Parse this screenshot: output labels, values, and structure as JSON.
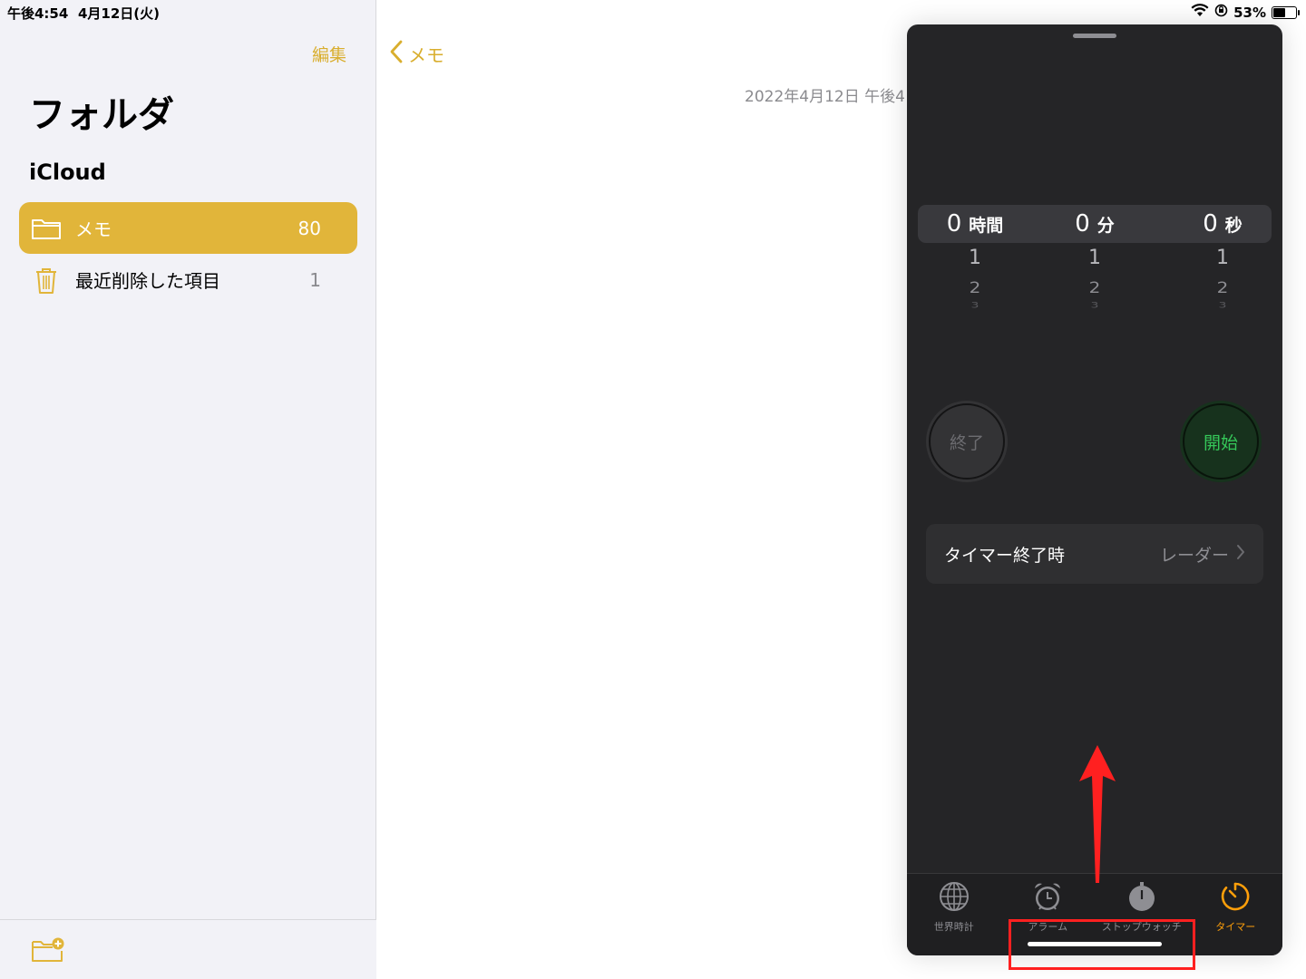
{
  "status_bar": {
    "time": "午後4:54",
    "date": "4月12日(火)",
    "battery": "53%",
    "battery_level": 0.53
  },
  "sidebar": {
    "edit_label": "編集",
    "title": "フォルダ",
    "section": "iCloud",
    "folders": [
      {
        "label": "メモ",
        "count": "80",
        "icon": "folder-icon",
        "selected": true
      },
      {
        "label": "最近削除した項目",
        "count": "1",
        "icon": "trash-icon",
        "selected": false
      }
    ],
    "new_folder_icon": "new-folder-icon"
  },
  "note": {
    "back_label": "メモ",
    "date_text": "2022年4月12日 午後4"
  },
  "clock_panel": {
    "picker": [
      {
        "value": "0",
        "unit": "時間",
        "next1": "1",
        "next2": "2",
        "next3": "3"
      },
      {
        "value": "0",
        "unit": "分",
        "next1": "1",
        "next2": "2",
        "next3": "3"
      },
      {
        "value": "0",
        "unit": "秒",
        "next1": "1",
        "next2": "2",
        "next3": "3"
      }
    ],
    "cancel_label": "終了",
    "start_label": "開始",
    "when_ends_label": "タイマー終了時",
    "when_ends_value": "レーダー",
    "tabs": [
      {
        "label": "世界時計",
        "icon": "globe-icon",
        "active": false
      },
      {
        "label": "アラーム",
        "icon": "alarm-clock-icon",
        "active": false
      },
      {
        "label": "ストップウォッチ",
        "icon": "stopwatch-icon",
        "active": false
      },
      {
        "label": "タイマー",
        "icon": "timer-icon",
        "active": true
      }
    ]
  },
  "colors": {
    "accent": "#e1b53a",
    "panel_bg": "#252527",
    "start_green": "#35c759",
    "timer_orange": "#ff9f0a",
    "annotation_red": "#ff2020"
  }
}
